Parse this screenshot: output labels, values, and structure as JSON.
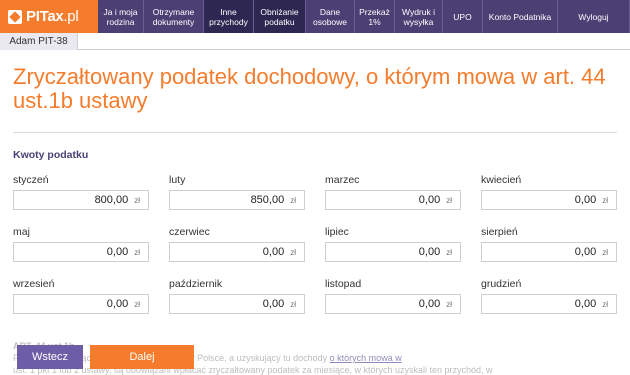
{
  "brand": {
    "logo_text_bold": "PITax",
    "logo_text_thin": ".pl"
  },
  "nav": [
    {
      "label": "Ja i moja rodzina",
      "width": 46
    },
    {
      "label": "Otrzymane dokumenty",
      "width": 60
    },
    {
      "label": "Inne przychody",
      "width": 50,
      "active": true
    },
    {
      "label": "Obniżanie podatku",
      "width": 52,
      "active": true
    },
    {
      "label": "Dane osobowe",
      "width": 49
    },
    {
      "label": "Przekaż 1%",
      "width": 40
    },
    {
      "label": "Wydruk i wysyłka",
      "width": 48
    },
    {
      "label": "UPO",
      "width": 40
    },
    {
      "label": "Konto Podatnika",
      "width": 75
    },
    {
      "label": "Wyloguj",
      "width": 72
    }
  ],
  "user_tab": "Adam PIT-38",
  "page_title": "Zryczałtowany podatek dochodowy, o którym mowa w art. 44 ust.1b ustawy",
  "section_label": "Kwoty podatku",
  "currency_unit": "zł",
  "months": [
    [
      {
        "label": "styczeń",
        "value": "800,00"
      },
      {
        "label": "luty",
        "value": "850,00"
      },
      {
        "label": "marzec",
        "value": "0,00"
      },
      {
        "label": "kwiecień",
        "value": "0,00"
      }
    ],
    [
      {
        "label": "maj",
        "value": "0,00"
      },
      {
        "label": "czerwiec",
        "value": "0,00"
      },
      {
        "label": "lipiec",
        "value": "0,00"
      },
      {
        "label": "sierpień",
        "value": "0,00"
      }
    ],
    [
      {
        "label": "wrzesień",
        "value": "0,00"
      },
      {
        "label": "październik",
        "value": "0,00"
      },
      {
        "label": "listopad",
        "value": "0,00"
      },
      {
        "label": "grudzień",
        "value": "0,00"
      }
    ]
  ],
  "faded_text": {
    "heading": "ART. 44 ust.1b",
    "line1_before": "Podatnicy niemający miejsca zamieszkania w Polsce, a uzyskujący tu dochody",
    "link": "o których mowa w",
    "line2": "ust. 1 pkt 1 lub 2 ustawy, są obowiązani wpłacać zryczałtowany podatek za miesiące, w których uzyskali ten przychód, w"
  },
  "buttons": {
    "back": "Wstecz",
    "next": "Dalej"
  }
}
